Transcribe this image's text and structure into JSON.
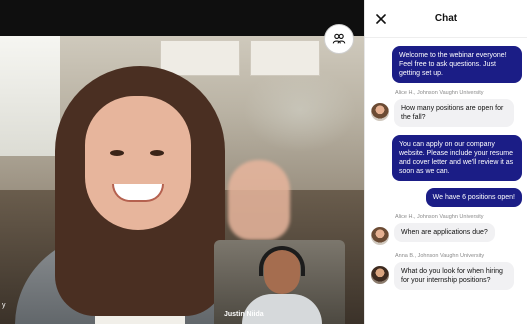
{
  "video": {
    "speaker_name": "Justin Niida",
    "edge_label": "y"
  },
  "chat": {
    "title": "Chat",
    "messages": [
      {
        "text": "Welcome to the webinar everyone! Feel free to ask questions. Just getting set up."
      },
      {
        "sender": "Alice H., Johnson Vaughn University",
        "text": "How many positions are open for the fall?"
      },
      {
        "text": "You can apply on our company website. Please include your resume and cover letter and we'll review it as soon as we can."
      },
      {
        "text": "We have 6 positions open!"
      },
      {
        "sender": "Alice H., Johnson Vaughn University",
        "text": "When are applications due?"
      },
      {
        "sender": "Anna B., Johnson Vaughn University",
        "text": "What do you look for when hiring for your internship positions?"
      }
    ]
  },
  "icons": {
    "participants": "participants-icon",
    "close": "close-icon"
  },
  "colors": {
    "outgoing_bubble": "#1b1d86",
    "incoming_bubble": "#f1f1f3"
  }
}
